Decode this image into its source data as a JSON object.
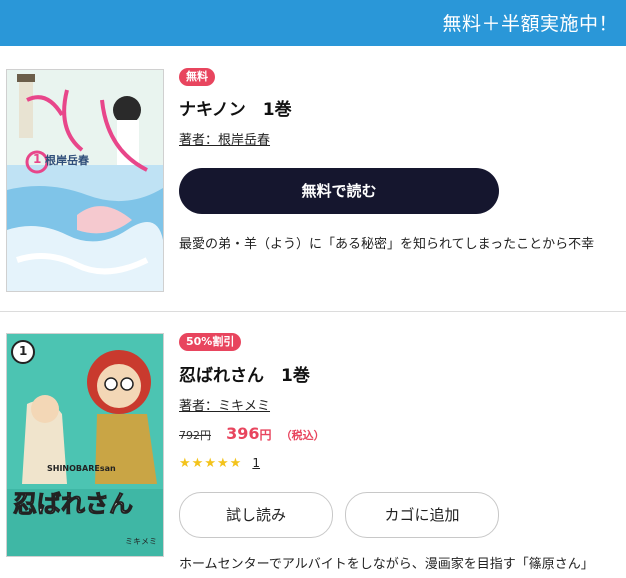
{
  "banner": {
    "text": "無料＋半額実施中！"
  },
  "items": [
    {
      "badge": "無料",
      "title": "ナキノン　1巻",
      "author": "著者：根岸岳春",
      "read_button": "無料で読む",
      "description": "最愛の弟・羊（よう）に「ある秘密」を知られてしまったことから不幸",
      "cover_text": "根岸岳春",
      "cover_volume": "1"
    },
    {
      "badge": "50%割引",
      "title": "忍ばれさん　1巻",
      "author": "著者：ミキメミ",
      "price_original": "792円",
      "price_sale": "396",
      "price_unit": "円",
      "price_tax": "（税込）",
      "rating_stars": 5,
      "review_count": "1",
      "trial_button": "試し読み",
      "cart_button": "カゴに追加",
      "description": "ホームセンターでアルバイトをしながら、漫画家を目指す「篠原さん」",
      "cover_title": "忍ばれさん",
      "cover_subtitle": "SHINOBAREsan",
      "cover_author": "ミキメミ",
      "cover_volume": "1"
    }
  ],
  "colors": {
    "banner": "#2a97d8",
    "badge": "#e8455e",
    "read_button": "#15162e",
    "price": "#e8455e",
    "star": "#f3c31b"
  }
}
